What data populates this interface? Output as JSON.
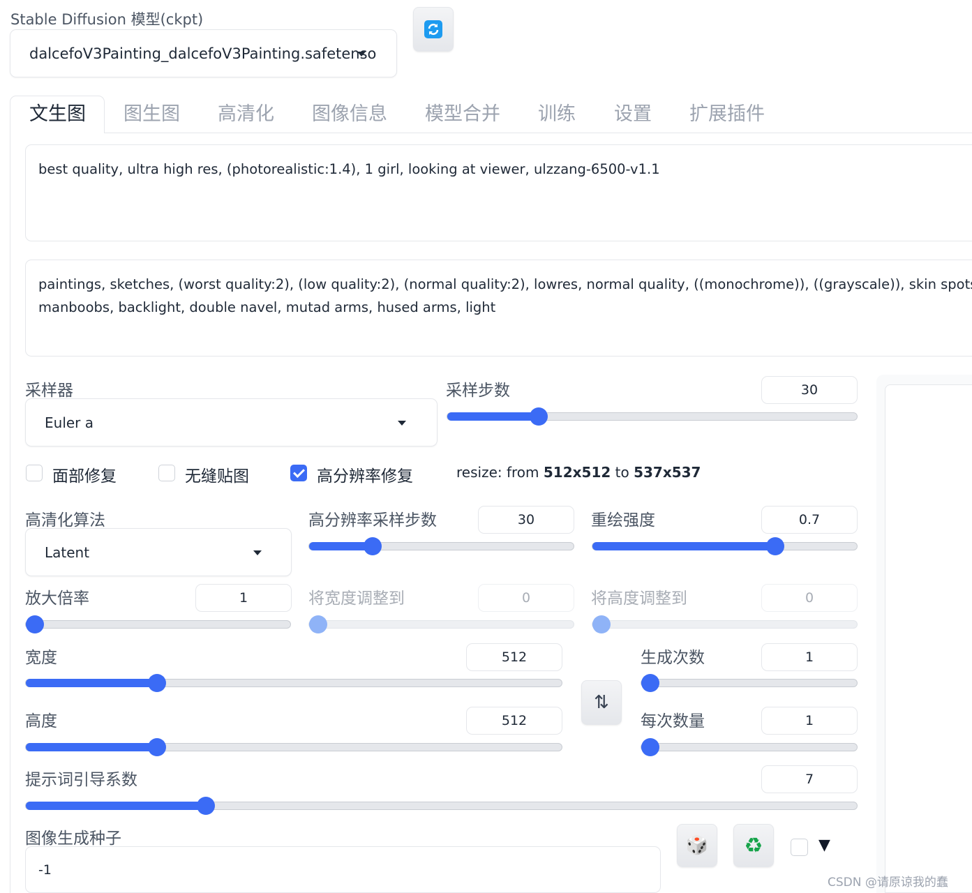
{
  "model": {
    "label": "Stable Diffusion 模型(ckpt)",
    "selected": "dalcefoV3Painting_dalcefoV3Painting.safetenso"
  },
  "tabs": [
    "文生图",
    "图生图",
    "高清化",
    "图像信息",
    "模型合并",
    "训练",
    "设置",
    "扩展插件"
  ],
  "prompt": {
    "positive": "best quality, ultra high res, (photorealistic:1.4), 1 girl, looking at viewer, ulzzang-6500-v1.1",
    "negative_line1": "paintings, sketches, (worst quality:2), (low quality:2), (normal quality:2), lowres, normal quality, ((monochrome)), ((grayscale)), skin spots, ac",
    "negative_line2": "manboobs, backlight, double navel, mutad arms, hused arms, light"
  },
  "sampler": {
    "label": "采样器",
    "value": "Euler a"
  },
  "steps": {
    "label": "采样步数",
    "value": "30",
    "fraction": 0.21
  },
  "checkboxes": {
    "face_restore": {
      "label": "面部修复",
      "checked": false
    },
    "tiling": {
      "label": "无缝贴图",
      "checked": false
    },
    "hires_fix": {
      "label": "高分辨率修复",
      "checked": true
    }
  },
  "resize_info": {
    "prefix": "resize: from ",
    "from": "512x512",
    "mid": " to ",
    "to": "537x537"
  },
  "upscaler": {
    "label": "高清化算法",
    "value": "Latent"
  },
  "hires_steps": {
    "label": "高分辨率采样步数",
    "value": "30",
    "fraction": 0.22
  },
  "denoise": {
    "label": "重绘强度",
    "value": "0.7",
    "fraction": 0.7
  },
  "upscale_by": {
    "label": "放大倍率",
    "value": "1",
    "fraction": 0.0
  },
  "resize_width": {
    "label": "将宽度调整到",
    "value": "0",
    "fraction": 0.0
  },
  "resize_height": {
    "label": "将高度调整到",
    "value": "0",
    "fraction": 0.0
  },
  "width": {
    "label": "宽度",
    "value": "512",
    "fraction": 0.235
  },
  "height": {
    "label": "高度",
    "value": "512",
    "fraction": 0.235
  },
  "batch_count": {
    "label": "生成次数",
    "value": "1",
    "fraction": 0.0
  },
  "batch_size": {
    "label": "每次数量",
    "value": "1",
    "fraction": 0.0
  },
  "cfg": {
    "label": "提示词引导系数",
    "value": "7",
    "fraction": 0.21
  },
  "seed": {
    "label": "图像生成种子",
    "value": "-1"
  },
  "icons": {
    "refresh": "refresh-icon",
    "swap": "⇅",
    "dice": "🎲",
    "recycle": "♻",
    "extra_toggle": "▼"
  },
  "colors": {
    "accent": "#3b6bf5",
    "refresh_icon": "#1d9bf0"
  },
  "watermark": "CSDN @请原谅我的蠢"
}
